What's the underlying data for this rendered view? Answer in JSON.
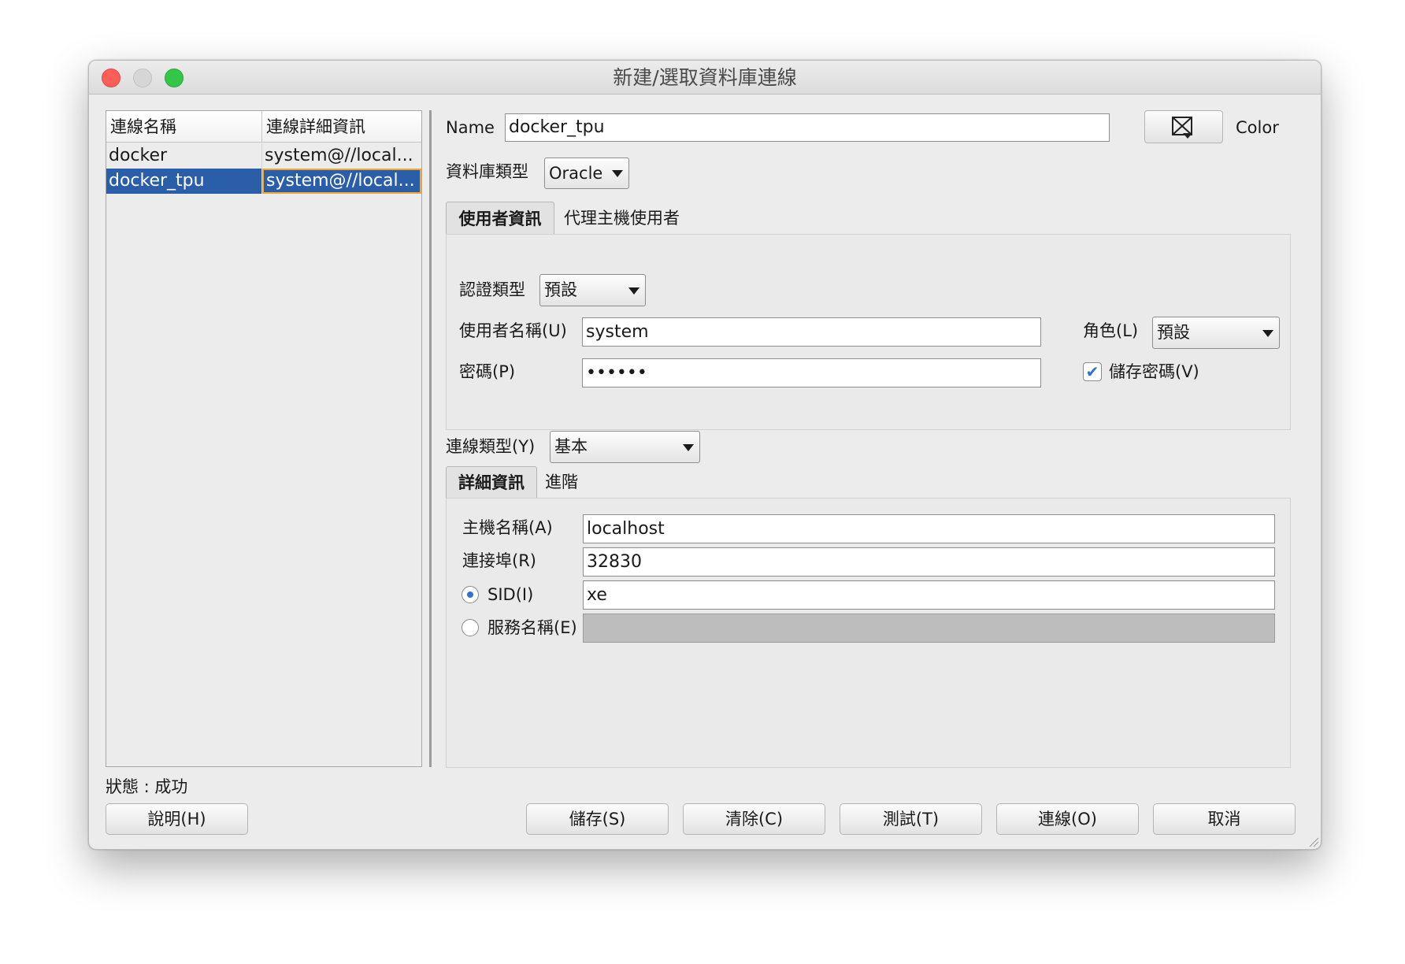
{
  "window": {
    "title": "新建/選取資料庫連線"
  },
  "connections": {
    "headers": [
      "連線名稱",
      "連線詳細資訊"
    ],
    "rows": [
      {
        "name": "docker",
        "details": "system@//local..."
      },
      {
        "name": "docker_tpu",
        "details": "system@//local..."
      }
    ],
    "selected_index": 1
  },
  "status": "狀態 : 成功",
  "form": {
    "name_label": "Name",
    "name_value": "docker_tpu",
    "color_label": "Color",
    "color_icon": "color-picker-icon",
    "db_type_label": "資料庫類型",
    "db_type_value": "Oracle",
    "tabs_user": [
      "使用者資訊",
      "代理主機使用者"
    ],
    "auth_type_label": "認證類型",
    "auth_type_value": "預設",
    "username_label": "使用者名稱(U)",
    "username_value": "system",
    "role_label": "角色(L)",
    "role_value": "預設",
    "password_label": "密碼(P)",
    "password_value": "••••••",
    "save_password_label": "儲存密碼(V)",
    "save_password_checked": true,
    "conn_type_label": "連線類型(Y)",
    "conn_type_value": "基本",
    "tabs_detail": [
      "詳細資訊",
      "進階"
    ],
    "host_label": "主機名稱(A)",
    "host_value": "localhost",
    "port_label": "連接埠(R)",
    "port_value": "32830",
    "sid_label": "SID(I)",
    "sid_value": "xe",
    "sid_selected": true,
    "service_label": "服務名稱(E)",
    "service_value": ""
  },
  "buttons": {
    "help": "說明(H)",
    "save": "儲存(S)",
    "clear": "清除(C)",
    "test": "測試(T)",
    "connect": "連線(O)",
    "cancel": "取消"
  },
  "colors": {
    "selection": "#2b5ea8",
    "focus_ring": "#f0a830",
    "close": "#fc5f57",
    "zoom": "#33c748",
    "radio_dot": "#2f72d6"
  }
}
